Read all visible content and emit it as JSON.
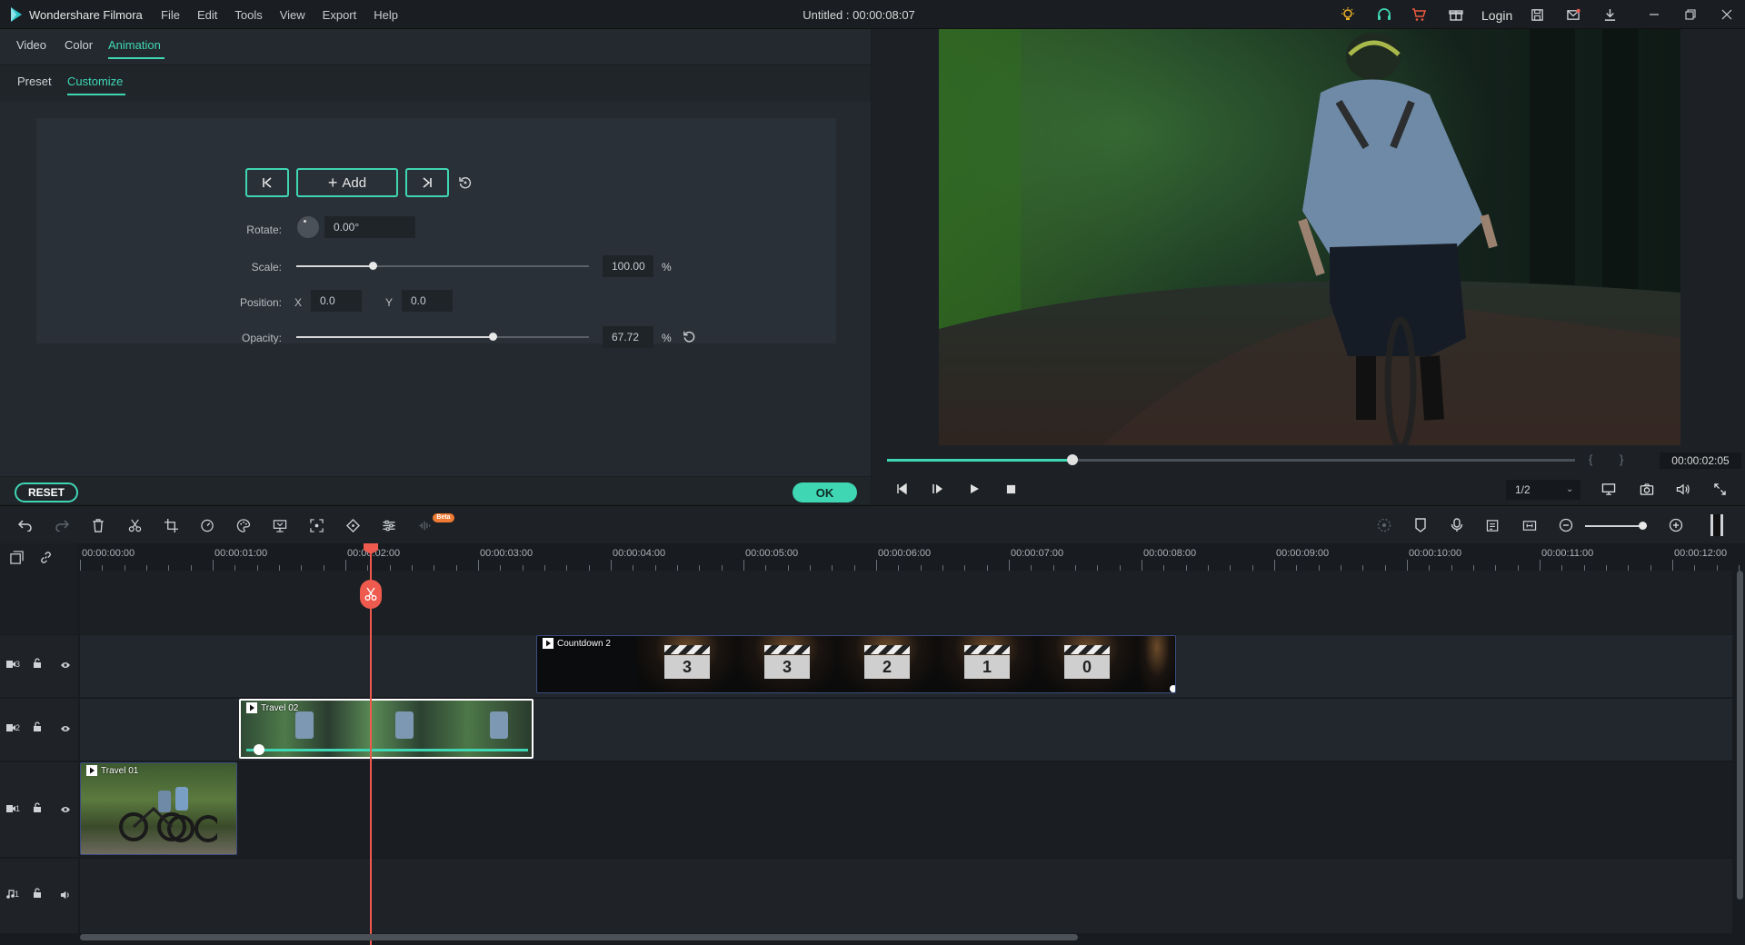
{
  "app": {
    "name": "Wondershare Filmora",
    "document_title": "Untitled : 00:00:08:07",
    "login": "Login"
  },
  "menu": [
    "File",
    "Edit",
    "Tools",
    "View",
    "Export",
    "Help"
  ],
  "editor_tabs": [
    "Video",
    "Color",
    "Animation"
  ],
  "editor_tabs_active": "Animation",
  "sub_tabs": [
    "Preset",
    "Customize"
  ],
  "sub_tabs_active": "Customize",
  "keyframe": {
    "add_label": "Add"
  },
  "props": {
    "rotate": {
      "label": "Rotate:",
      "value": "0.00°"
    },
    "scale": {
      "label": "Scale:",
      "value": "100.00",
      "unit": "%",
      "level": 0.26
    },
    "position": {
      "label": "Position:",
      "x_label": "X",
      "x_value": "0.0",
      "y_label": "Y",
      "y_value": "0.0"
    },
    "opacity": {
      "label": "Opacity:",
      "value": "67.72",
      "unit": "%",
      "level": 0.67
    }
  },
  "buttons": {
    "reset": "RESET",
    "ok": "OK"
  },
  "preview": {
    "timecode": "00:00:02:05",
    "ratio": "1/2",
    "progress": 0.27
  },
  "ruler": [
    "00:00:00:00",
    "00:00:01:00",
    "00:00:02:00",
    "00:00:03:00",
    "00:00:04:00",
    "00:00:05:00",
    "00:00:06:00",
    "00:00:07:00",
    "00:00:08:00",
    "00:00:09:00",
    "00:00:10:00",
    "00:00:11:00",
    "00:00:12:00"
  ],
  "tracks": {
    "v3": {
      "label": "3",
      "clip": "Countdown 2"
    },
    "v2": {
      "label": "2",
      "clip": "Travel 02"
    },
    "v1": {
      "label": "1",
      "clip": "Travel 01"
    },
    "a1": {
      "label": "1"
    }
  },
  "countdown_numbers": [
    "3",
    "3",
    "2",
    "1",
    "0"
  ],
  "badge": "Beta",
  "colors": {
    "accent": "#3fd6b3",
    "playhead": "#ef5a4e",
    "panel": "#24292f"
  }
}
